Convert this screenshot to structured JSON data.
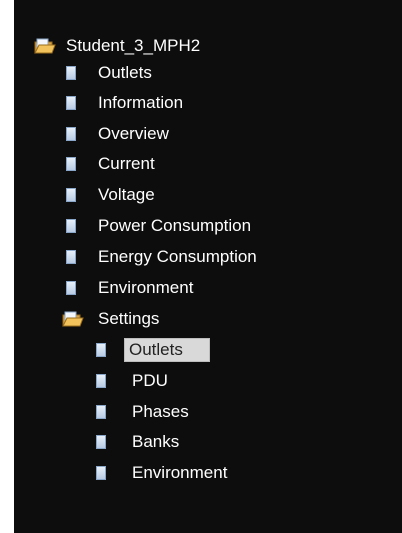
{
  "tree": {
    "root": {
      "label": "Student_3_MPH2",
      "icon": "folder-open-icon"
    },
    "children": [
      {
        "label": "Outlets",
        "icon": "page-icon"
      },
      {
        "label": "Information",
        "icon": "page-icon"
      },
      {
        "label": "Overview",
        "icon": "page-icon"
      },
      {
        "label": "Current",
        "icon": "page-icon"
      },
      {
        "label": "Voltage",
        "icon": "page-icon"
      },
      {
        "label": "Power Consumption",
        "icon": "page-icon"
      },
      {
        "label": "Energy Consumption",
        "icon": "page-icon"
      },
      {
        "label": "Environment",
        "icon": "page-icon"
      }
    ],
    "settings": {
      "label": "Settings",
      "icon": "folder-open-icon",
      "children": [
        {
          "label": "Outlets",
          "icon": "page-icon",
          "selected": true
        },
        {
          "label": "PDU",
          "icon": "page-icon"
        },
        {
          "label": "Phases",
          "icon": "page-icon"
        },
        {
          "label": "Banks",
          "icon": "page-icon"
        },
        {
          "label": "Environment",
          "icon": "page-icon"
        }
      ]
    }
  },
  "colors": {
    "panel_background": "#0d0d0d",
    "text": "#ffffff",
    "selection_background": "#d9d9d9",
    "folder_icon": "#e8b84a",
    "page_icon": "#c9d8ee"
  }
}
